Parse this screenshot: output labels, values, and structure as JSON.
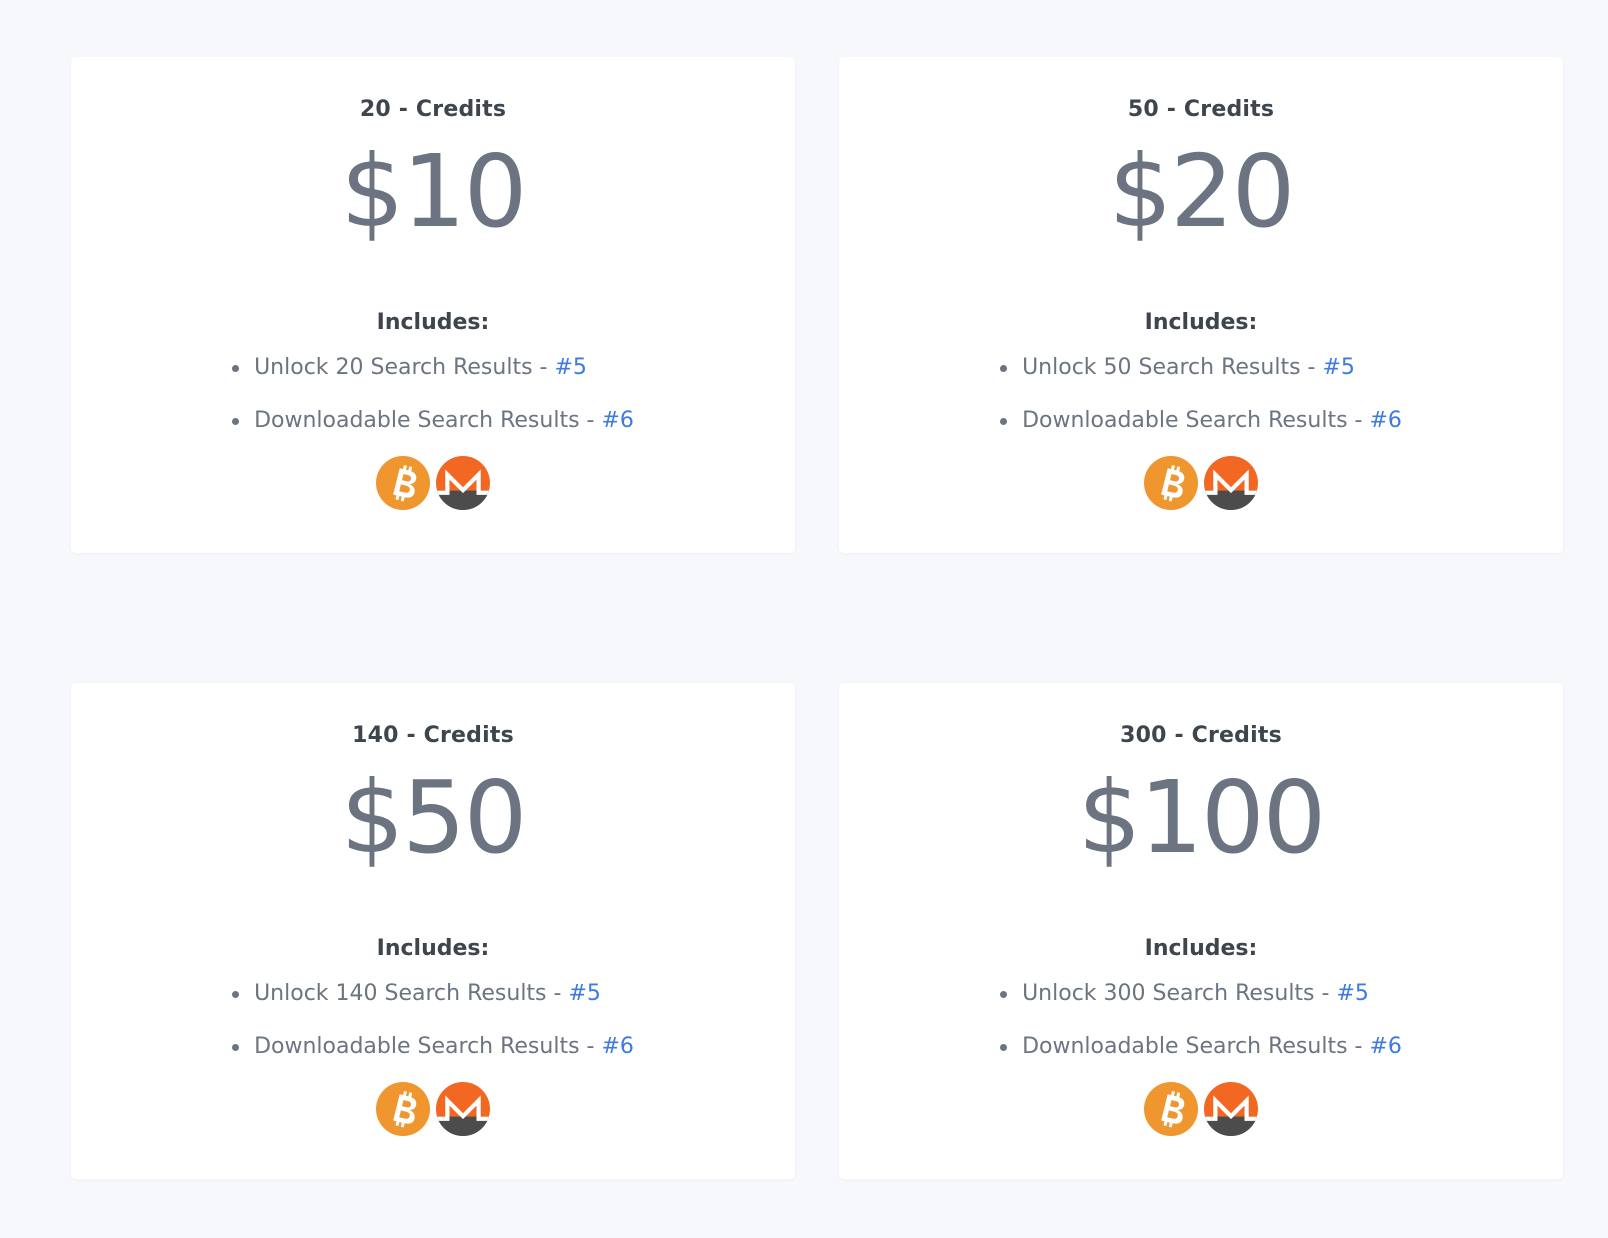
{
  "plans": [
    {
      "credits": "20 - Credits",
      "price": "$10",
      "includes": "Includes:",
      "features": [
        {
          "text": "Unlock 20 Search Results - ",
          "link": "#5"
        },
        {
          "text": "Downloadable Search Results - ",
          "link": "#6"
        }
      ]
    },
    {
      "credits": "50 - Credits",
      "price": "$20",
      "includes": "Includes:",
      "features": [
        {
          "text": "Unlock 50 Search Results - ",
          "link": "#5"
        },
        {
          "text": "Downloadable Search Results - ",
          "link": "#6"
        }
      ]
    },
    {
      "credits": "140 - Credits",
      "price": "$50",
      "includes": "Includes:",
      "features": [
        {
          "text": "Unlock 140 Search Results - ",
          "link": "#5"
        },
        {
          "text": "Downloadable Search Results - ",
          "link": "#6"
        }
      ]
    },
    {
      "credits": "300 - Credits",
      "price": "$100",
      "includes": "Includes:",
      "features": [
        {
          "text": "Unlock 300 Search Results - ",
          "link": "#5"
        },
        {
          "text": "Downloadable Search Results - ",
          "link": "#6"
        }
      ]
    }
  ],
  "payment_icons": [
    "bitcoin-icon",
    "monero-icon"
  ],
  "colors": {
    "background": "#f7f8fb",
    "card": "#ffffff",
    "heading": "#3e454d",
    "muted": "#6b7480",
    "link": "#3f7ae0",
    "bitcoin": "#f0962f",
    "monero_orange": "#f26822",
    "monero_dark": "#4c4c4c"
  }
}
